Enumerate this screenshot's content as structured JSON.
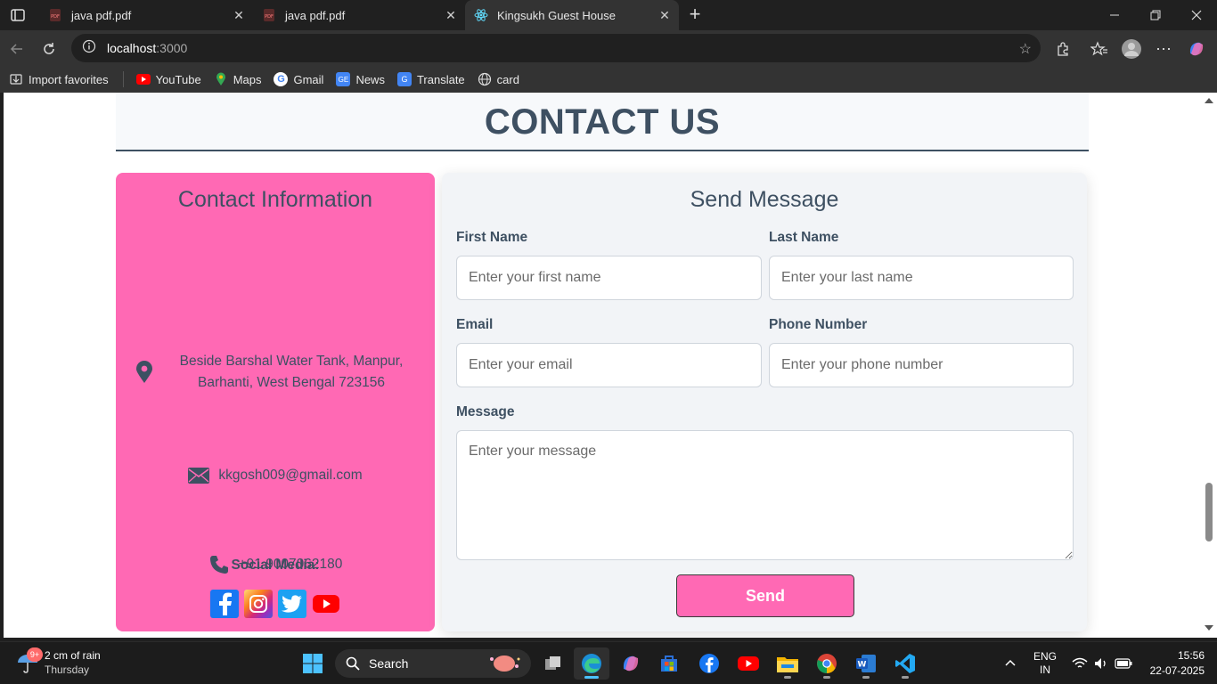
{
  "browser": {
    "tabs": [
      {
        "title": "java pdf.pdf",
        "icon": "pdf-icon",
        "active": false
      },
      {
        "title": "java pdf.pdf",
        "icon": "pdf-icon",
        "active": false
      },
      {
        "title": "Kingsukh Guest House",
        "icon": "react-icon",
        "active": true
      }
    ],
    "url_host": "localhost",
    "url_port": ":3000",
    "favorites": [
      {
        "label": "Import favorites",
        "icon": "import-icon"
      },
      {
        "label": "YouTube",
        "icon": "youtube-icon"
      },
      {
        "label": "Maps",
        "icon": "maps-icon"
      },
      {
        "label": "Gmail",
        "icon": "google-icon"
      },
      {
        "label": "News",
        "icon": "news-icon"
      },
      {
        "label": "Translate",
        "icon": "translate-icon"
      },
      {
        "label": "card",
        "icon": "globe-icon"
      }
    ]
  },
  "page": {
    "heading": "CONTACT US",
    "contact_info": {
      "title": "Contact Information",
      "address_line1": "Beside Barshal Water Tank, Manpur,",
      "address_line2": "Barhanti, West Bengal 723156",
      "email": "kkgosh009@gmail.com",
      "phone": "+91 9007062180",
      "social_title": "Social Media:",
      "social": [
        "facebook-icon",
        "instagram-icon",
        "twitter-icon",
        "youtube-icon"
      ]
    },
    "form": {
      "title": "Send Message",
      "first_name_label": "First Name",
      "first_name_placeholder": "Enter your first name",
      "last_name_label": "Last Name",
      "last_name_placeholder": "Enter your last name",
      "email_label": "Email",
      "email_placeholder": "Enter your email",
      "phone_label": "Phone Number",
      "phone_placeholder": "Enter your phone number",
      "message_label": "Message",
      "message_placeholder": "Enter your message",
      "send_label": "Send"
    },
    "colors": {
      "accent_pink": "#ff69b4",
      "heading_slate": "#3e5062"
    }
  },
  "taskbar": {
    "weather_line1": "2 cm of rain",
    "weather_line2": "Thursday",
    "notification_count": "9+",
    "search_label": "Search",
    "lang_line1": "ENG",
    "lang_line2": "IN",
    "time": "15:56",
    "date": "22-07-2025"
  }
}
